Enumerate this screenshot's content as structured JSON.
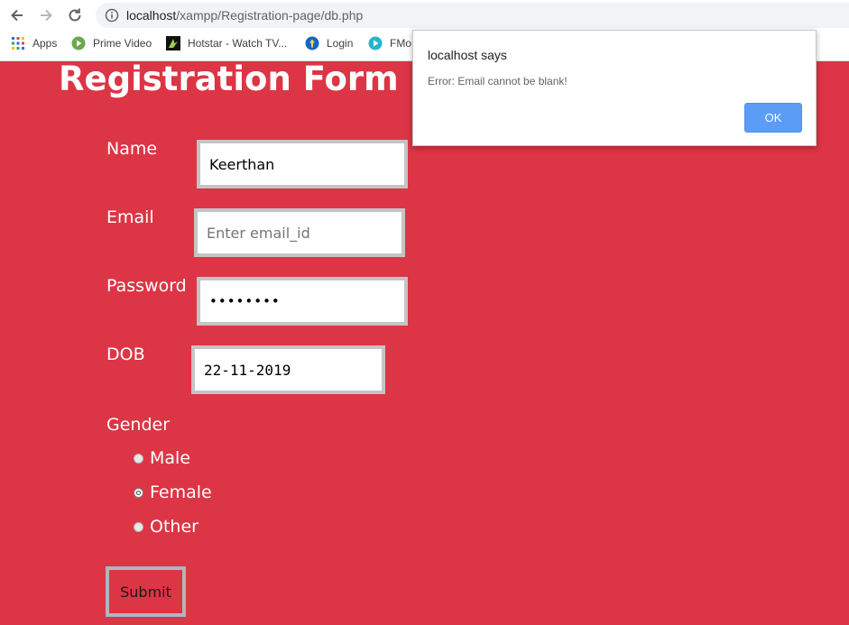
{
  "browser": {
    "url_host": "localhost",
    "url_path": "/xampp/Registration-page/db.php",
    "bookmarks": [
      {
        "label": "Apps",
        "icon": "apps-grid-icon"
      },
      {
        "label": "Prime Video",
        "icon": "prime-video-icon"
      },
      {
        "label": "Hotstar - Watch TV...",
        "icon": "hotstar-icon"
      },
      {
        "label": "Login",
        "icon": "login-icon"
      },
      {
        "label": "FMo",
        "icon": "fmovies-icon"
      }
    ]
  },
  "form": {
    "title": "Registration Form",
    "name_label": "Name",
    "name_value": "Keerthan",
    "email_label": "Email",
    "email_placeholder": "Enter email_id",
    "password_label": "Password",
    "password_value": "••••••••",
    "dob_label": "DOB",
    "dob_value": "22-11-2019",
    "gender_label": "Gender",
    "gender_options": [
      "Male",
      "Female",
      "Other"
    ],
    "gender_selected": "Female",
    "submit_label": "Submit"
  },
  "alert": {
    "title": "localhost says",
    "message": "Error: Email cannot be blank!",
    "ok_label": "OK"
  },
  "colors": {
    "page_background": "#dc3545",
    "alert_ok_button": "#5b9cf6"
  }
}
